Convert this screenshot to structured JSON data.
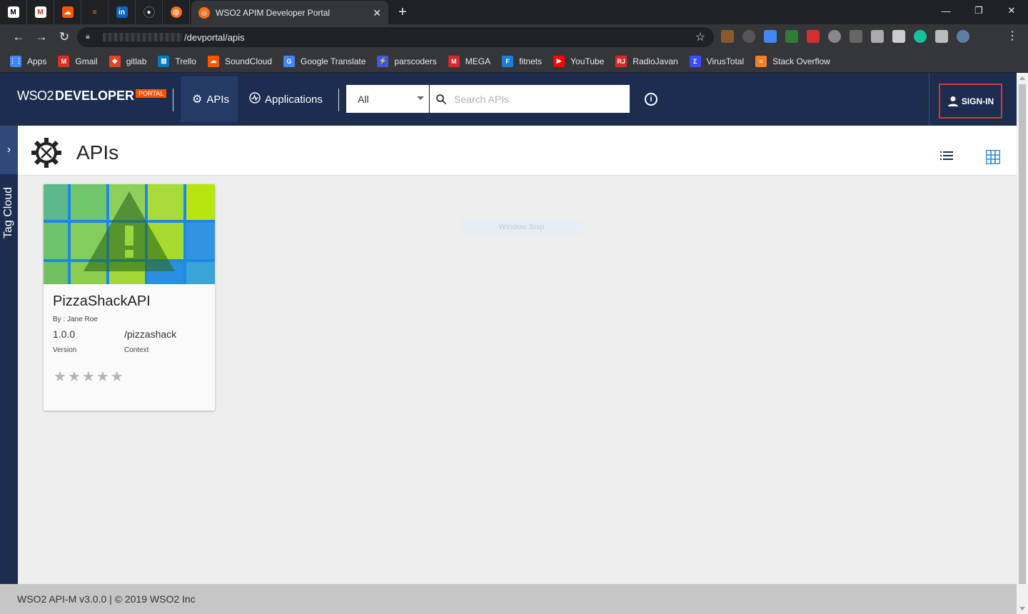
{
  "browser": {
    "active_tab_title": "WSO2 APIM Developer Portal",
    "url_path": "/devportal/apis",
    "pinned_tabs": [
      {
        "icon": "medium-icon",
        "color": "#ffffff"
      },
      {
        "icon": "gmail-icon",
        "color": "#d93025"
      },
      {
        "icon": "soundcloud-icon",
        "color": "#ff5500"
      },
      {
        "icon": "stackoverflow-icon",
        "color": "#f48024"
      },
      {
        "icon": "linkedin-icon",
        "color": "#0a66c2"
      },
      {
        "icon": "github-icon",
        "color": "#202124"
      },
      {
        "icon": "wso2-icon",
        "color": "#f37021"
      }
    ],
    "bookmarks": [
      {
        "label": "Apps",
        "icon": "apps-grid-icon",
        "color": "#4285f4"
      },
      {
        "label": "Gmail",
        "icon": "gmail-icon",
        "color": "#d93025"
      },
      {
        "label": "gitlab",
        "icon": "gitlab-icon",
        "color": "#e24329"
      },
      {
        "label": "Trello",
        "icon": "trello-icon",
        "color": "#0079bf"
      },
      {
        "label": "SoundCloud",
        "icon": "soundcloud-icon",
        "color": "#ff5500"
      },
      {
        "label": "Google Translate",
        "icon": "google-translate-icon",
        "color": "#4285f4"
      },
      {
        "label": "parscoders",
        "icon": "parscoders-icon",
        "color": "#3b5bdb"
      },
      {
        "label": "MEGA",
        "icon": "mega-icon",
        "color": "#d9272e"
      },
      {
        "label": "fitnets",
        "icon": "fitnets-icon",
        "color": "#1c7ed6"
      },
      {
        "label": "YouTube",
        "icon": "youtube-icon",
        "color": "#ff0000"
      },
      {
        "label": "RadioJavan",
        "icon": "radiojavan-icon",
        "color": "#d9272e"
      },
      {
        "label": "VirusTotal",
        "icon": "virustotal-icon",
        "color": "#394eff"
      },
      {
        "label": "Stack Overflow",
        "icon": "stackoverflow-icon",
        "color": "#f48024"
      }
    ]
  },
  "header": {
    "logo_wso2": "WSO2",
    "logo_developer": "DEVELOPER",
    "logo_portal": "PORTAL",
    "nav": [
      {
        "label": "APIs",
        "icon": "gear-icon",
        "active": true
      },
      {
        "label": "Applications",
        "icon": "activity-icon",
        "active": false
      }
    ],
    "search_scope": "All",
    "search_placeholder": "Search APIs",
    "signin_label": "SIGN-IN"
  },
  "sidebar": {
    "tag_cloud_label": "Tag Cloud"
  },
  "page": {
    "title": "APIs"
  },
  "apis": [
    {
      "name": "PizzaShackAPI",
      "by": "By : Jane Roe",
      "version": "1.0.0",
      "version_label": "Version",
      "context": "/pizzashack",
      "context_label": "Context",
      "rating": 0,
      "max_rating": 5
    }
  ],
  "overlay": {
    "window_snip": "Window Snip"
  },
  "footer": {
    "text": "WSO2 API-M v3.0.0 | © 2019 WSO2 Inc"
  },
  "colors": {
    "header_bg": "#1c2d4f",
    "nav_active_bg": "#243b66",
    "portal_badge": "#ff5000",
    "signin_border": "#e03131",
    "grid_view_accent": "#1e88e5"
  }
}
